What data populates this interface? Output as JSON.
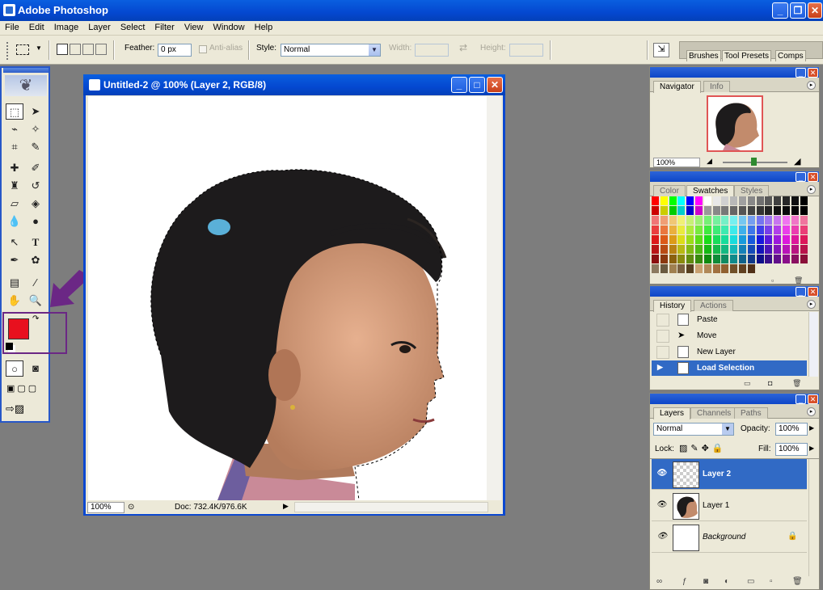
{
  "app": {
    "title": "Adobe Photoshop"
  },
  "menu": [
    "File",
    "Edit",
    "Image",
    "Layer",
    "Select",
    "Filter",
    "View",
    "Window",
    "Help"
  ],
  "options": {
    "feather_label": "Feather:",
    "feather_value": "0 px",
    "antialias_label": "Anti-alias",
    "style_label": "Style:",
    "style_value": "Normal",
    "width_label": "Width:",
    "height_label": "Height:"
  },
  "palette_well": {
    "tabs": [
      "Brushes",
      "Tool Presets",
      "Comps"
    ]
  },
  "document": {
    "title": "Untitled-2 @ 100% (Layer 2, RGB/8)",
    "zoom": "100%",
    "doc_info": "Doc: 732.4K/976.6K"
  },
  "navigator": {
    "tabs": [
      "Navigator",
      "Info"
    ],
    "zoom": "100%"
  },
  "color_palette": {
    "tabs": [
      "Color",
      "Swatches",
      "Styles"
    ]
  },
  "history": {
    "tabs": [
      "History",
      "Actions"
    ],
    "items": [
      "Paste",
      "Move",
      "New Layer",
      "Load Selection"
    ],
    "selected": "Load Selection"
  },
  "layers": {
    "tabs": [
      "Layers",
      "Channels",
      "Paths"
    ],
    "blend_mode": "Normal",
    "opacity_label": "Opacity:",
    "opacity": "100%",
    "lock_label": "Lock:",
    "fill_label": "Fill:",
    "fill": "100%",
    "items": [
      "Layer 2",
      "Layer 1",
      "Background"
    ],
    "selected": "Layer 2"
  },
  "colors": {
    "foreground": "#e8101e",
    "background": "#ffffff",
    "accent": "#0a5fe0",
    "annotation": "#6b2785"
  }
}
